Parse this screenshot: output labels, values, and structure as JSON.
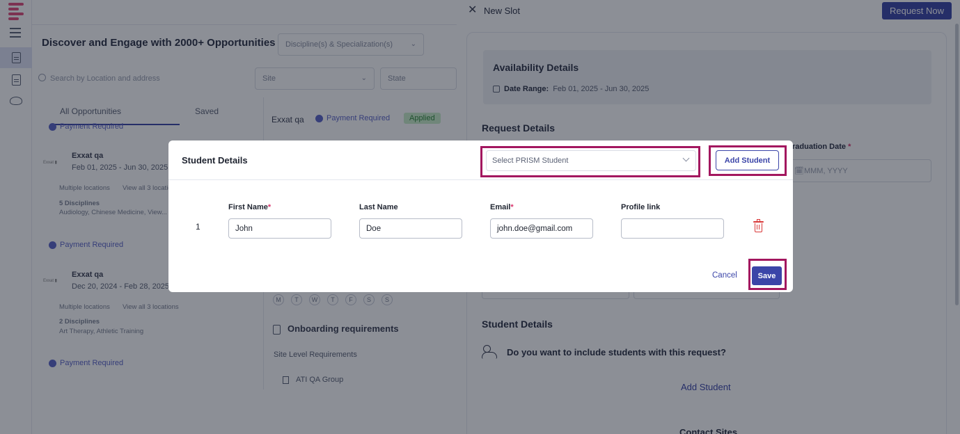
{
  "background": {
    "left": {
      "heading": "Discover and Engage with 2000+ Opportunities",
      "discipline_placeholder": "Discipline(s) & Specialization(s)",
      "search_placeholder": "Search by Location and address",
      "site_placeholder": "Site",
      "state_placeholder": "State",
      "tabs": [
        "All Opportunities",
        "Saved"
      ],
      "cards": [
        {
          "badge": "Payment Required",
          "name": "Exxat qa",
          "dates": "Feb 01, 2025 - Jun 30, 2025",
          "locations": "Multiple locations",
          "view_all": "View all 3 locations",
          "disciplines_count": "5 Disciplines",
          "disciplines": "Audiology, Chinese Medicine, View..."
        },
        {
          "badge": "Payment Required",
          "name": "Exxat qa",
          "dates": "Dec 20, 2024 - Feb 28, 2025",
          "locations": "Multiple locations",
          "view_all": "View all 3 locations",
          "disciplines_count": "2 Disciplines",
          "disciplines": "Art Therapy, Athletic Training"
        }
      ],
      "third_badge": "Payment Required",
      "middle": {
        "site_name": "Exxat qa",
        "badge": "Payment Required",
        "status": "Applied",
        "days": [
          "M",
          "T",
          "W",
          "T",
          "F",
          "S",
          "S"
        ],
        "onboarding_title": "Onboarding requirements",
        "site_level": "Site Level Requirements",
        "group": "ATI QA Group"
      }
    },
    "drawer": {
      "title": "New Slot",
      "request_button": "Request Now",
      "availability": {
        "title": "Availability Details",
        "range_label": "Date Range:",
        "range_value": "Feb 01, 2025 - Jun 30, 2025"
      },
      "request_details_title": "Request Details",
      "graduation_label": "raduation Date",
      "graduation_placeholder": "MMM, YYYY",
      "student_details_title": "Student Details",
      "student_question": "Do you want to include students with this request?",
      "add_student_link": "Add Student",
      "contact_sites": "Contact Sites"
    }
  },
  "modal": {
    "title": "Student Details",
    "prism_placeholder": "Select PRISM Student",
    "add_student_button": "Add Student",
    "columns": {
      "first_name": "First Name",
      "last_name": "Last Name",
      "email": "Email",
      "profile_link": "Profile link"
    },
    "required_mark": "*",
    "rows": [
      {
        "index": "1",
        "first_name": "John",
        "last_name": "Doe",
        "email": "john.doe@gmail.com",
        "profile_link": ""
      }
    ],
    "cancel_label": "Cancel",
    "save_label": "Save"
  },
  "colors": {
    "primary": "#3b45a8",
    "highlight": "#a3175f",
    "danger": "#d93838",
    "required": "#d9336b"
  }
}
